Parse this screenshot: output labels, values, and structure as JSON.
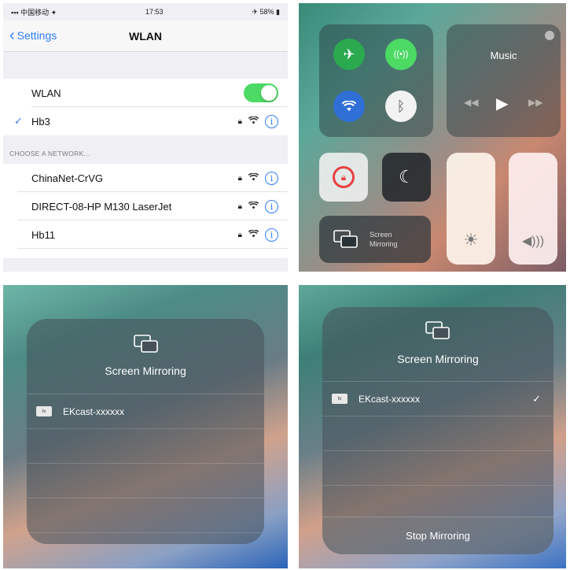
{
  "wlan": {
    "status_left": "▪︎▪︎▪︎ 中国移动 ✦",
    "status_time": "17:53",
    "status_right": "✈ 58% ▮",
    "back_label": "Settings",
    "title": "WLAN",
    "wlan_label": "WLAN",
    "connected_network": "Hb3",
    "section_label": "CHOOSE A NETWORK...",
    "networks": [
      "ChinaNet-CrVG",
      "DIRECT-08-HP M130 LaserJet",
      "Hb11"
    ]
  },
  "control_center": {
    "music_title": "Music",
    "screen_label_line1": "Screen",
    "screen_label_line2": "Mirroring",
    "colors": {
      "airplane": "#2aa94f",
      "cellular": "#4cd964",
      "wifi": "#2f6fd6",
      "bluetooth": "#ffffff",
      "lock": "#e84040"
    }
  },
  "mirror_left": {
    "title": "Screen Mirroring",
    "device_badge": "tv",
    "device_name": "EKcast-xxxxxx"
  },
  "mirror_right": {
    "title": "Screen Mirroring",
    "device_badge": "tv",
    "device_name": "EKcast-xxxxxx",
    "check": "✓",
    "stop_label": "Stop Mirroring"
  }
}
